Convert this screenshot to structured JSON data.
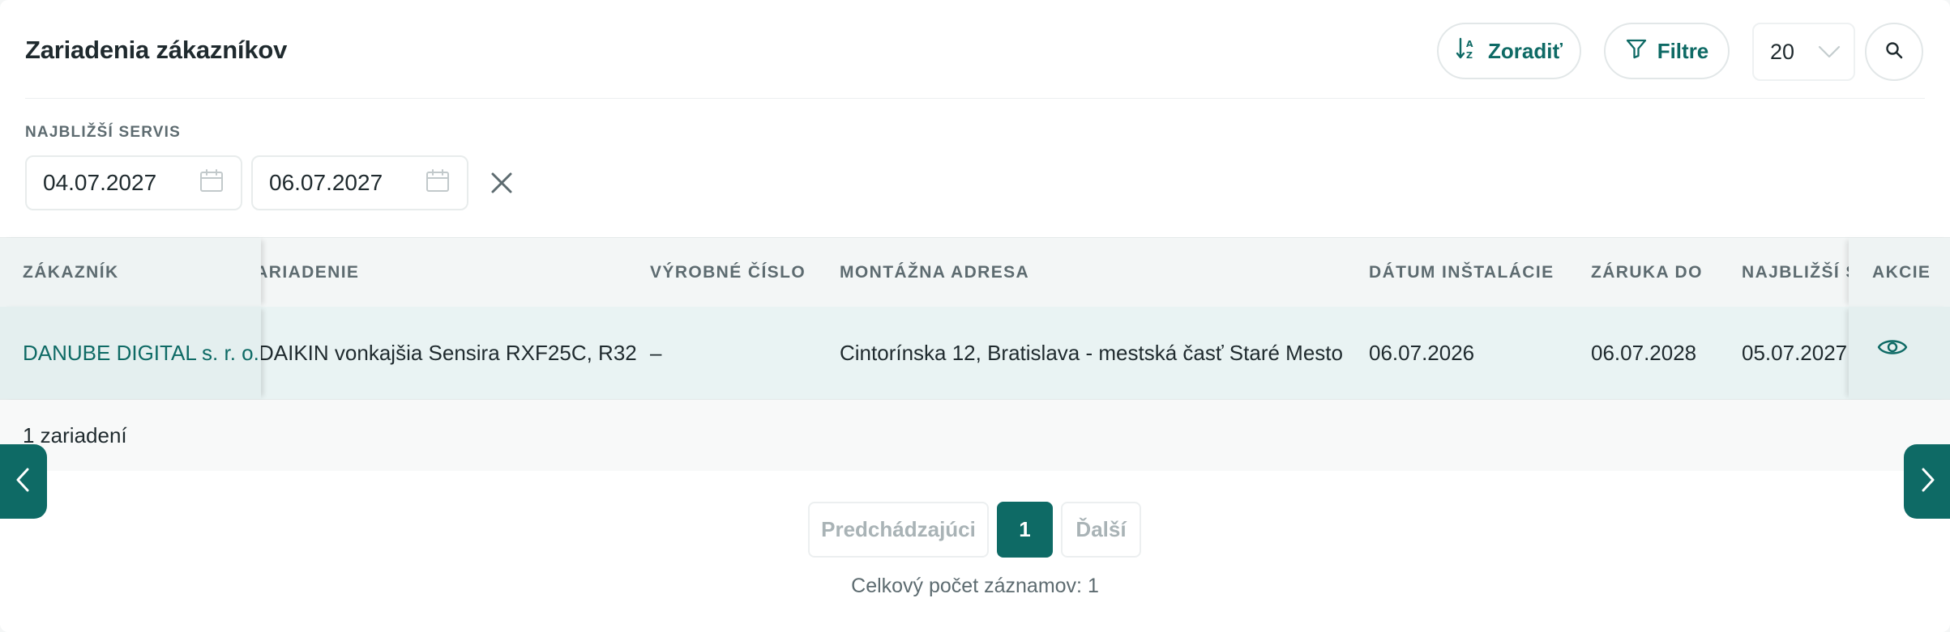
{
  "header": {
    "title": "Zariadenia zákazníkov",
    "sort_label": "Zoradiť",
    "filter_label": "Filtre",
    "per_page": "20"
  },
  "filter": {
    "label": "NAJBLIŽŠÍ SERVIS",
    "date_from": "04.07.2027",
    "date_to": "06.07.2027"
  },
  "table": {
    "columns": {
      "customer": "ZÁKAZNÍK",
      "device": "ZARIADENIE",
      "serial": "VÝROBNÉ ČÍSLO",
      "address": "MONTÁŽNA ADRESA",
      "install_date": "DÁTUM INŠTALÁCIE",
      "warranty": "ZÁRUKA DO",
      "next_service": "NAJBLIŽŠÍ SERVIS",
      "actions": "AKCIE"
    },
    "rows": [
      {
        "customer": "DANUBE DIGITAL s. r. o.",
        "device": "DAIKIN vonkajšia Sensira RXF25C, R32",
        "serial": "–",
        "address": "Cintorínska 12, Bratislava - mestská časť Staré Mesto",
        "install_date": "06.07.2026",
        "warranty": "06.07.2028",
        "next_service": "05.07.2027"
      }
    ],
    "footer_count": "1 zariadení"
  },
  "pagination": {
    "prev": "Predchádzajúci",
    "current": "1",
    "next": "Ďalší",
    "total": "Celkový počet záznamov: 1"
  },
  "colors": {
    "accent": "#0e6a65",
    "row_bg": "#e9f3f3"
  },
  "icons": {
    "sort": "sort-az-icon",
    "filter": "funnel-icon",
    "dropdown": "chevron-down-icon",
    "search": "search-icon",
    "calendar": "calendar-icon",
    "clear": "close-icon",
    "view": "eye-icon",
    "prev": "chevron-left-icon",
    "next": "chevron-right-icon"
  }
}
